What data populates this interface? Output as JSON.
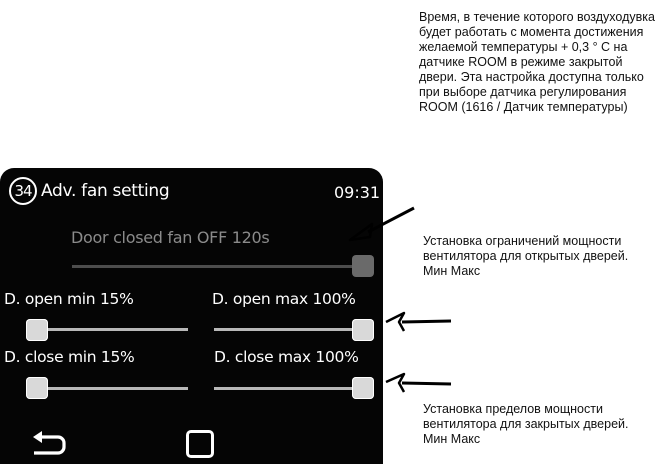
{
  "screen": {
    "number": "34",
    "title": "Adv. fan setting",
    "time": "09:31",
    "door_closed_setting": "Door closed fan OFF  120s",
    "door_closed_slider_level": 1.0,
    "sliders": [
      {
        "label": "D. open min 15%",
        "level": 0.0
      },
      {
        "label": "D. open max 100%",
        "level": 1.0
      },
      {
        "label": "D. close min 15%",
        "level": 0.0
      },
      {
        "label": "D. close max 100%",
        "level": 1.0
      }
    ],
    "icons": {
      "back": "back-arrow-icon",
      "home": "home-square-icon"
    }
  },
  "annotations": {
    "top": "Время, в течение которого воздуходувка будет работать с момента достижения желаемой температуры + 0,3 ° C на датчике ROOM в режиме закрытой двери. Эта настройка доступна только при выборе датчика регулирования ROOM (1616 / Датчик температуры)",
    "middle": "Установка ограничений мощности вентилятора для открытых дверей. Мин Макс",
    "bottom": "Установка пределов мощности вентилятора для закрытых дверей. Мин Макс"
  }
}
